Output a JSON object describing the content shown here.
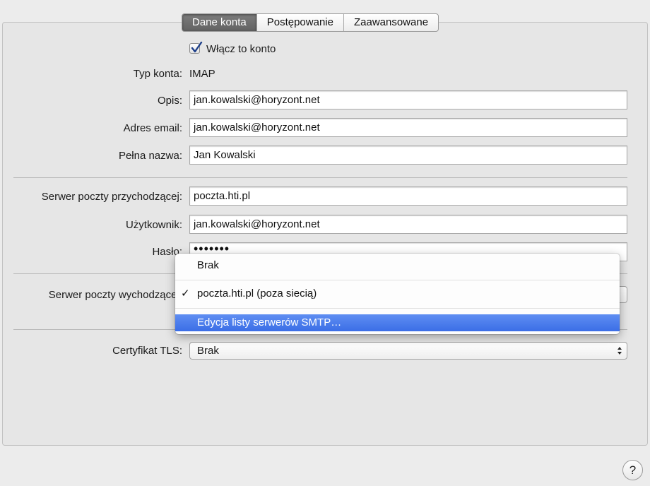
{
  "tabs": [
    "Dane konta",
    "Postępowanie",
    "Zaawansowane"
  ],
  "enable_account": {
    "label": "Włącz to konto",
    "checked": true
  },
  "account_type": {
    "label": "Typ konta:",
    "value": "IMAP"
  },
  "description": {
    "label": "Opis:",
    "value": "jan.kowalski@horyzont.net"
  },
  "email": {
    "label": "Adres email:",
    "value": "jan.kowalski@horyzont.net"
  },
  "full_name": {
    "label": "Pełna nazwa:",
    "value": "Jan Kowalski"
  },
  "incoming_server": {
    "label": "Serwer poczty przychodzącej:",
    "value": "poczta.hti.pl"
  },
  "username": {
    "label": "Użytkownik:",
    "value": "jan.kowalski@horyzont.net"
  },
  "password": {
    "label": "Hasło:",
    "value": "•••••••"
  },
  "outgoing_server": {
    "label": "Serwer poczty wychodzącej:"
  },
  "smtp_menu": {
    "items": [
      "Brak",
      "poczta.hti.pl (poza siecią)",
      "Edycja listy serwerów SMTP…"
    ],
    "checked_mark": "✓"
  },
  "tls_certificate": {
    "label": "Certyfikat TLS:",
    "value": "Brak"
  },
  "help_label": "?"
}
